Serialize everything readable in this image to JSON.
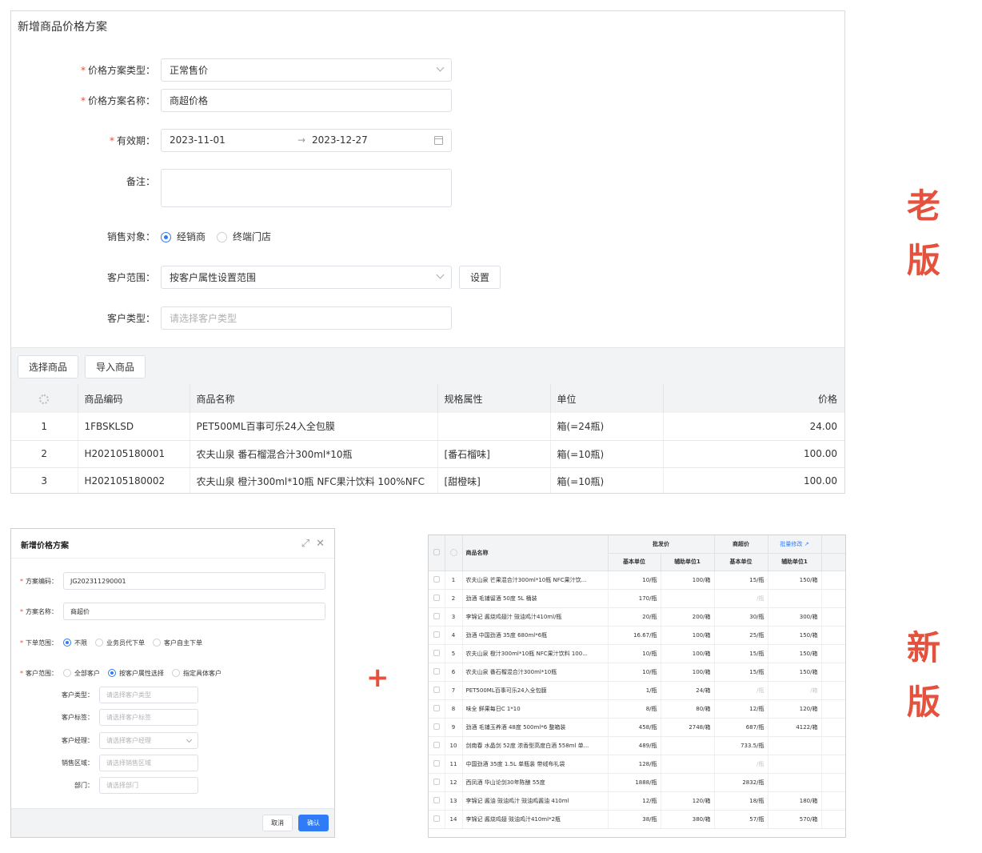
{
  "old": {
    "title": "新增商品价格方案",
    "price_type": {
      "label": "价格方案类型：",
      "value": "正常售价"
    },
    "price_name": {
      "label": "价格方案名称：",
      "value": "商超价格"
    },
    "validity": {
      "label": "有效期：",
      "start": "2023-11-01",
      "arrow": "→",
      "end": "2023-12-27"
    },
    "remark": {
      "label": "备注："
    },
    "sale_target": {
      "label": "销售对象：",
      "options": [
        "经销商",
        "终端门店"
      ]
    },
    "customer_range": {
      "label": "客户范围：",
      "value": "按客户属性设置范围",
      "button": "设置"
    },
    "customer_type": {
      "label": "客户类型：",
      "placeholder": "请选择客户类型"
    },
    "toolbar": {
      "select_goods": "选择商品",
      "import_goods": "导入商品"
    },
    "grid": {
      "columns": [
        "商品编码",
        "商品名称",
        "规格属性",
        "单位",
        "价格"
      ],
      "rows": [
        {
          "no": "1",
          "code": "1FBSKLSD",
          "name": "PET500ML百事可乐24入全包膜",
          "spec": "",
          "unit": "箱(=24瓶)",
          "price": "24.00"
        },
        {
          "no": "2",
          "code": "H202105180001",
          "name": "农夫山泉 番石榴混合汁300ml*10瓶",
          "spec": "[番石榴味]",
          "unit": "箱(=10瓶)",
          "price": "100.00"
        },
        {
          "no": "3",
          "code": "H202105180002",
          "name": "农夫山泉 橙汁300ml*10瓶 NFC果汁饮料 100%NFC",
          "spec": "[甜橙味]",
          "unit": "箱(=10瓶)",
          "price": "100.00"
        }
      ]
    }
  },
  "tags": {
    "old_1": "老",
    "old_2": "版",
    "new_1": "新",
    "new_2": "版",
    "plus": "+"
  },
  "dialog": {
    "title": "新增价格方案",
    "code": {
      "label": "方案编码：",
      "value": "JG202311290001"
    },
    "name": {
      "label": "方案名称：",
      "value": "商超价"
    },
    "order_range": {
      "label": "下单范围：",
      "options": [
        "不限",
        "业务员代下单",
        "客户自主下单"
      ]
    },
    "customer_range": {
      "label": "客户范围：",
      "options": [
        "全部客户",
        "按客户属性选择",
        "指定具体客户"
      ]
    },
    "sub": [
      {
        "label": "客户类型：",
        "placeholder": "请选择客户类型"
      },
      {
        "label": "客户标签：",
        "placeholder": "请选择客户标签"
      },
      {
        "label": "客户经理：",
        "placeholder": "请选择客户经理"
      },
      {
        "label": "销售区域：",
        "placeholder": "请选择销售区域"
      },
      {
        "label": "部门：",
        "placeholder": "请选择部门"
      }
    ],
    "cancel": "取消",
    "ok": "确认"
  },
  "new_grid": {
    "header": {
      "name": "商品名称",
      "wholesale": "批发价",
      "supermarket": "商超价",
      "batch_edit": "批量修改",
      "base_unit": "基本单位",
      "aux_unit": "辅助单位1"
    },
    "rows": [
      {
        "no": "1",
        "name": "农夫山泉 芒果混合汁300ml*10瓶 NFC果汁饮...",
        "w_base": "10/瓶",
        "w_aux": "100/箱",
        "s_base": "15/瓶",
        "s_aux": "150/箱"
      },
      {
        "no": "2",
        "name": "劲酒 毛铺留酒 50度 5L 桶装",
        "w_base": "170/瓶",
        "w_aux": "",
        "s_base": "/瓶",
        "s_aux": ""
      },
      {
        "no": "3",
        "name": "李锦记 酱烧鸡翅汁 豉油鸡汁410ml/瓶",
        "w_base": "20/瓶",
        "w_aux": "200/箱",
        "s_base": "30/瓶",
        "s_aux": "300/箱"
      },
      {
        "no": "4",
        "name": "劲酒 中国劲酒 35度 680ml*6瓶",
        "w_base": "16.67/瓶",
        "w_aux": "100/箱",
        "s_base": "25/瓶",
        "s_aux": "150/箱"
      },
      {
        "no": "5",
        "name": "农夫山泉 橙汁300ml*10瓶 NFC果汁饮料 100...",
        "w_base": "10/瓶",
        "w_aux": "100/箱",
        "s_base": "15/瓶",
        "s_aux": "150/箱"
      },
      {
        "no": "6",
        "name": "农夫山泉 番石榴混合汁300ml*10瓶",
        "w_base": "10/瓶",
        "w_aux": "100/箱",
        "s_base": "15/瓶",
        "s_aux": "150/箱"
      },
      {
        "no": "7",
        "name": "PET500ML百事可乐24入全包膜",
        "w_base": "1/瓶",
        "w_aux": "24/箱",
        "s_base": "/瓶",
        "s_aux": "/箱"
      },
      {
        "no": "8",
        "name": "味全 鲜果每日C 1*10",
        "w_base": "8/瓶",
        "w_aux": "80/箱",
        "s_base": "12/瓶",
        "s_aux": "120/箱"
      },
      {
        "no": "9",
        "name": "劲酒 毛铺玉养酒 48度 500ml*6 整箱装",
        "w_base": "458/瓶",
        "w_aux": "2748/箱",
        "s_base": "687/瓶",
        "s_aux": "4122/箱"
      },
      {
        "no": "10",
        "name": "剑南春 水晶剑 52度 浓香型高度白酒 558ml 单...",
        "w_base": "489/瓶",
        "w_aux": "",
        "s_base": "733.5/瓶",
        "s_aux": ""
      },
      {
        "no": "11",
        "name": "中国劲酒 35度 1.5L 单瓶装 带绒布礼袋",
        "w_base": "128/瓶",
        "w_aux": "",
        "s_base": "/瓶",
        "s_aux": ""
      },
      {
        "no": "12",
        "name": "西凤酒 华山论剑30年陈酿 55度",
        "w_base": "1888/瓶",
        "w_aux": "",
        "s_base": "2832/瓶",
        "s_aux": ""
      },
      {
        "no": "13",
        "name": "李锦记 酱油 豉油鸡汁 豉油鸡酱油 410ml",
        "w_base": "12/瓶",
        "w_aux": "120/箱",
        "s_base": "18/瓶",
        "s_aux": "180/箱"
      },
      {
        "no": "14",
        "name": "李锦记 酱烧鸡翅 豉油鸡汁410ml*2瓶",
        "w_base": "38/瓶",
        "w_aux": "380/箱",
        "s_base": "57/瓶",
        "s_aux": "570/箱"
      }
    ]
  }
}
